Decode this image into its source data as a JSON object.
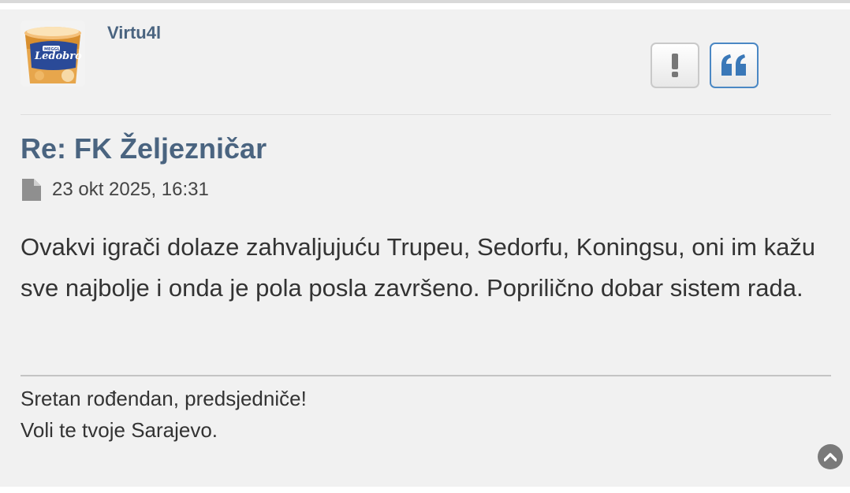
{
  "post": {
    "author": "Virtu4l",
    "avatar_icon": "ice-cream-tub-avatar",
    "avatar_text": "Ledobro",
    "avatar_brand": "MEGGLE",
    "title": "Re: FK Željezničar",
    "date": "23 okt 2025, 16:31",
    "body": "Ovakvi igrači dolaze zahvaljujuću Trupeu, Sedorfu, Koningsu, oni im kažu sve najbolje i onda je pola posla završeno. Popriličnо dobar sistem rada.",
    "signature_lines": [
      "Sretan rođendan, predsjedniče!",
      "Voli te tvoje Sarajevo."
    ]
  },
  "actions": {
    "report_icon": "exclamation-icon",
    "quote_icon": "quote-icon"
  },
  "footer": {
    "top_icon": "chevron-up-circle-icon"
  },
  "colors": {
    "link": "#4a6480",
    "quote_accent": "#3a78b8",
    "background": "#f1f1f1"
  }
}
